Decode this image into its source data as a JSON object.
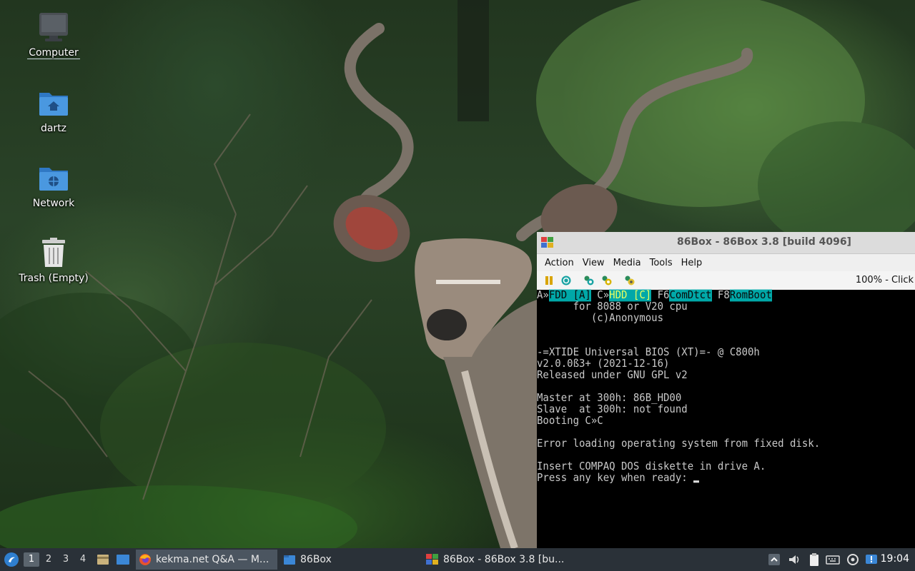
{
  "desktop": {
    "icons": [
      {
        "label": "Computer",
        "icon": "computer-icon"
      },
      {
        "label": "dartz",
        "icon": "home-folder-icon"
      },
      {
        "label": "Network",
        "icon": "network-folder-icon"
      },
      {
        "label": "Trash (Empty)",
        "icon": "trash-icon"
      }
    ]
  },
  "window": {
    "title": "86Box - 86Box 3.8 [build 4096]",
    "menu": [
      {
        "label": "Action",
        "mnemonic": "A"
      },
      {
        "label": "View",
        "mnemonic": "V"
      },
      {
        "label": "Media",
        "mnemonic": "M"
      },
      {
        "label": "Tools",
        "mnemonic": "T"
      },
      {
        "label": "Help",
        "mnemonic": "H"
      }
    ],
    "toolbar": {
      "buttons": [
        "pause-icon",
        "reset-icon",
        "ctrl-alt-del-icon",
        "ctrl-alt-esc-icon",
        "settings-icon"
      ],
      "status": "100% - Click"
    },
    "screen": {
      "boot_prefix_a": "A»",
      "boot_fdd": "FDD [A]",
      "boot_prefix_c": " C»",
      "boot_hdd": "HDD [C]",
      "boot_f6": " F6",
      "boot_comdtct": "ComDtct",
      "boot_f8": " F8",
      "boot_romboot": "RomBoot",
      "lines": [
        "      for 8088 or V20 cpu",
        "         (c)Anonymous",
        "",
        "",
        "-=XTIDE Universal BIOS (XT)=- @ C800h",
        "v2.0.0ß3+ (2021-12-16)",
        "Released under GNU GPL v2",
        "",
        "Master at 300h: 86B_HD00",
        "Slave  at 300h: not found",
        "Booting C»C",
        "",
        "Error loading operating system from fixed disk.",
        "",
        "Insert COMPAQ DOS diskette in drive A.",
        "Press any key when ready: "
      ]
    }
  },
  "taskbar": {
    "workspaces": [
      "1",
      "2",
      "3",
      "4"
    ],
    "active_workspace": "1",
    "tasks": [
      {
        "label": "kekma.net Q&A — M...",
        "icon": "firefox-icon"
      },
      {
        "label": "86Box",
        "icon": "folder-icon"
      },
      {
        "label": "86Box - 86Box 3.8 [bu...",
        "icon": "86box-icon"
      }
    ],
    "clock": "19:04"
  },
  "colors": {
    "taskbar_bg": "#2a3138",
    "screen_highlight": "#00a8a8",
    "folder_blue": "#3b87d6"
  }
}
